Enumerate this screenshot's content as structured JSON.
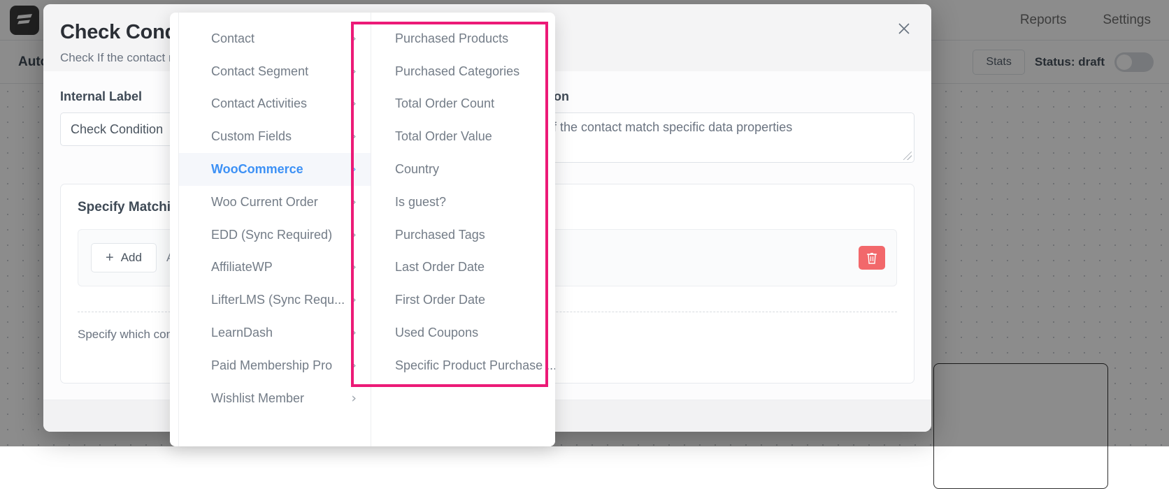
{
  "app": {
    "brand_name": "FluentCRM",
    "nav": [
      {
        "label": "Reports",
        "active": false
      },
      {
        "label": "Settings",
        "active": false
      }
    ],
    "subbar": {
      "title": "Automations",
      "stats_label": "Stats",
      "status_label": "Status: draft"
    }
  },
  "modal": {
    "title": "Check Condition",
    "subtitle": "Check If the contact match specific data properties",
    "close_icon": "close-icon",
    "internal_label": {
      "label": "Internal Label",
      "value": "Check Condition"
    },
    "description": {
      "label": "Description",
      "value": "Check If the contact match specific data properties"
    },
    "card": {
      "title": "Specify Matching Conditions",
      "add_button": "Add",
      "add_plus": "+",
      "and_text": "AND",
      "delete_icon": "trash-icon",
      "hint": "Specify which conditions will be matched to go blocks"
    }
  },
  "menu": {
    "groups": [
      {
        "label": "Contact",
        "active": false
      },
      {
        "label": "Contact Segment",
        "active": false
      },
      {
        "label": "Contact Activities",
        "active": false
      },
      {
        "label": "Custom Fields",
        "active": false
      },
      {
        "label": "WooCommerce",
        "active": true
      },
      {
        "label": "Woo Current Order",
        "active": false
      },
      {
        "label": "EDD (Sync Required)",
        "active": false
      },
      {
        "label": "AffiliateWP",
        "active": false
      },
      {
        "label": "LifterLMS (Sync Requ...",
        "active": false
      },
      {
        "label": "LearnDash",
        "active": false
      },
      {
        "label": "Paid Membership Pro",
        "active": false
      },
      {
        "label": "Wishlist Member",
        "active": false
      }
    ],
    "items": [
      {
        "label": "Purchased Products"
      },
      {
        "label": "Purchased Categories"
      },
      {
        "label": "Total Order Count"
      },
      {
        "label": "Total Order Value"
      },
      {
        "label": "Country"
      },
      {
        "label": "Is guest?"
      },
      {
        "label": "Purchased Tags"
      },
      {
        "label": "Last Order Date"
      },
      {
        "label": "First Order Date"
      },
      {
        "label": "Used Coupons"
      },
      {
        "label": "Specific Product Purchase ..."
      }
    ],
    "chevron": "›",
    "annotation_color": "#ec1a77"
  }
}
